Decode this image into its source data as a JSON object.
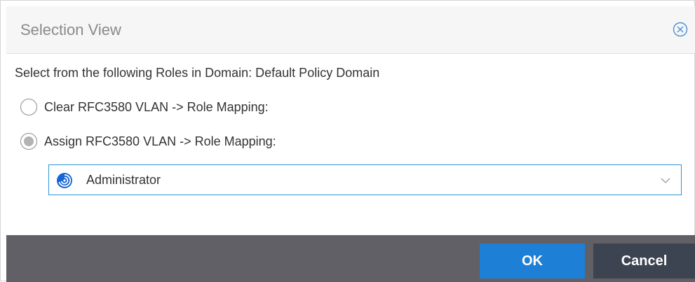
{
  "dialog": {
    "title": "Selection View",
    "close_icon": "circle-x-icon"
  },
  "prompt": "Select from the following Roles in Domain: Default Policy Domain",
  "options": [
    {
      "label": "Clear RFC3580 VLAN -> Role Mapping:",
      "checked": false
    },
    {
      "label": "Assign RFC3580 VLAN -> Role Mapping:",
      "checked": true
    }
  ],
  "role_select": {
    "value": "Administrator",
    "icon": "role-swirl-icon",
    "dropdown_icon": "chevron-down-icon"
  },
  "buttons": {
    "ok_label": "OK",
    "cancel_label": "Cancel"
  },
  "colors": {
    "accent": "#1e7fd6",
    "cancel": "#3b4450",
    "footer": "#606066",
    "select_border": "#2e95d6"
  }
}
